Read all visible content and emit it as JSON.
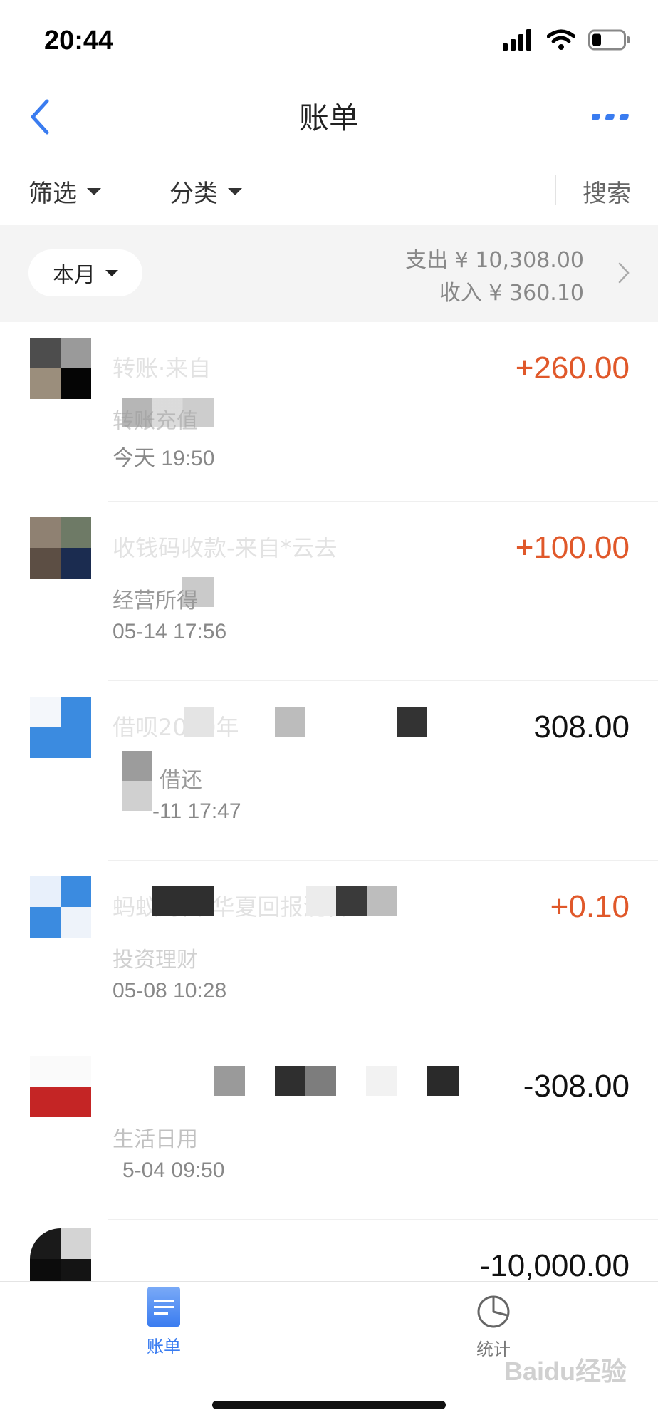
{
  "status_bar": {
    "time": "20:44"
  },
  "nav": {
    "title": "账单"
  },
  "filters": {
    "filter_label": "筛选",
    "category_label": "分类",
    "search_label": "搜索"
  },
  "summary": {
    "period": "本月",
    "expense_label": "支出",
    "expense_value": "¥ 10,308.00",
    "income_label": "收入",
    "income_value": "¥ 360.10"
  },
  "transactions": [
    {
      "title": "转账·来自",
      "category": "转账充值",
      "time": "今天  19:50",
      "amount": "+260.00",
      "type": "income"
    },
    {
      "title": "收钱码收款-来自*云去",
      "category": "经营所得",
      "time": "05-14  17:56",
      "amount": "+100.00",
      "type": "income"
    },
    {
      "title": "借呗2020年",
      "category": "借还",
      "time": "-11  17:47",
      "amount": "308.00",
      "type": "expense"
    },
    {
      "title": "蚂蚁财富-华夏回报混合",
      "category": "投资理财",
      "time": "05-08  10:28",
      "amount": "+0.10",
      "type": "income"
    },
    {
      "title": "",
      "category": "生活日用",
      "time": "5-04  09:50",
      "amount": "-308.00",
      "type": "expense"
    },
    {
      "title": "",
      "category": "",
      "time": "",
      "amount": "-10,000.00",
      "type": "expense"
    }
  ],
  "tab_bar": {
    "ledger_label": "账单",
    "stats_label": "统计"
  },
  "watermark": "Baidu经验",
  "colors": {
    "accent": "#3a7cf0",
    "income": "#e0582a",
    "expense": "#111111"
  },
  "icons": {
    "back": "chevron-left-icon",
    "more": "more-dots-icon",
    "summary_arrow": "chevron-right-icon",
    "ledger_tab": "ledger-doc-icon",
    "stats_tab": "pie-chart-icon"
  }
}
